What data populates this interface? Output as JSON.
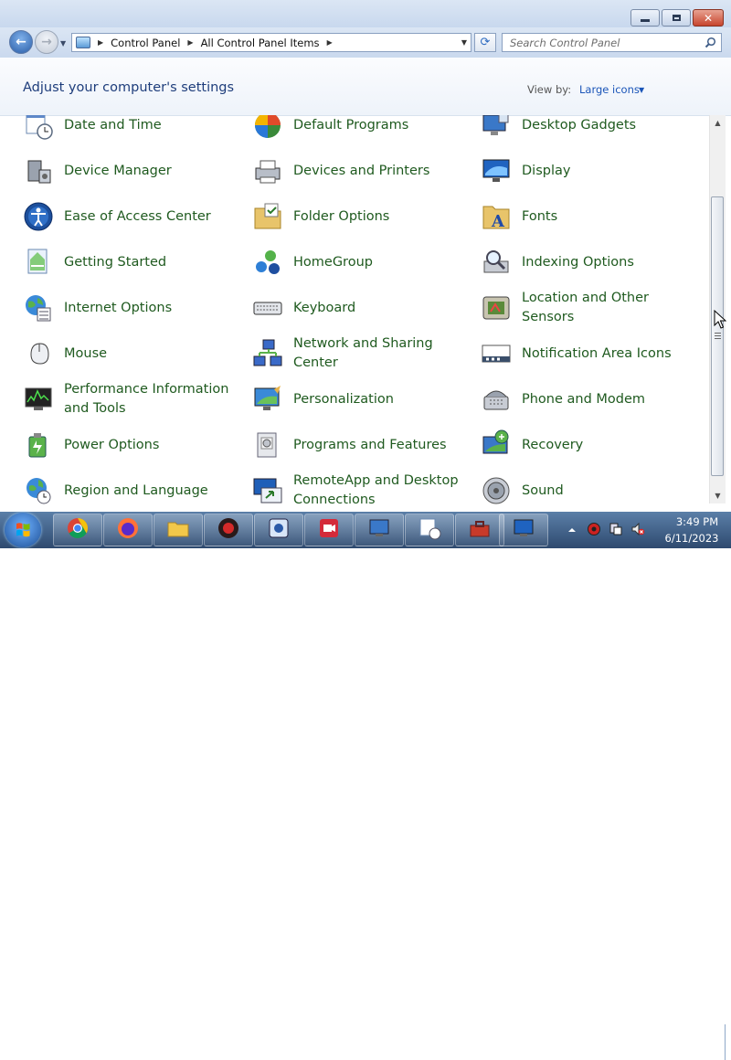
{
  "window": {
    "title_buttons": [
      "minimize",
      "maximize",
      "close"
    ],
    "close_glyph": "✕"
  },
  "nav": {
    "back_glyph": "←",
    "forward_glyph": "→",
    "breadcrumbs": [
      "Control Panel",
      "All Control Panel Items"
    ],
    "search_placeholder": "Search Control Panel"
  },
  "header": {
    "heading": "Adjust your computer's settings",
    "view_by_label": "View by:",
    "view_by_value": "Large icons"
  },
  "items": [
    {
      "label": "Date and Time",
      "icon": "date-time-icon"
    },
    {
      "label": "Default Programs",
      "icon": "default-programs-icon"
    },
    {
      "label": "Desktop Gadgets",
      "icon": "desktop-gadgets-icon"
    },
    {
      "label": "Device Manager",
      "icon": "device-manager-icon"
    },
    {
      "label": "Devices and Printers",
      "icon": "devices-printers-icon"
    },
    {
      "label": "Display",
      "icon": "display-icon"
    },
    {
      "label": "Ease of Access Center",
      "icon": "ease-of-access-icon"
    },
    {
      "label": "Folder Options",
      "icon": "folder-options-icon"
    },
    {
      "label": "Fonts",
      "icon": "fonts-icon"
    },
    {
      "label": "Getting Started",
      "icon": "getting-started-icon"
    },
    {
      "label": "HomeGroup",
      "icon": "homegroup-icon"
    },
    {
      "label": "Indexing Options",
      "icon": "indexing-options-icon"
    },
    {
      "label": "Internet Options",
      "icon": "internet-options-icon"
    },
    {
      "label": "Keyboard",
      "icon": "keyboard-icon"
    },
    {
      "label": "Location and Other Sensors",
      "icon": "location-sensors-icon"
    },
    {
      "label": "Mouse",
      "icon": "mouse-icon"
    },
    {
      "label": "Network and Sharing Center",
      "icon": "network-sharing-icon"
    },
    {
      "label": "Notification Area Icons",
      "icon": "notification-area-icon"
    },
    {
      "label": "Performance Information and Tools",
      "icon": "performance-icon"
    },
    {
      "label": "Personalization",
      "icon": "personalization-icon"
    },
    {
      "label": "Phone and Modem",
      "icon": "phone-modem-icon"
    },
    {
      "label": "Power Options",
      "icon": "power-options-icon"
    },
    {
      "label": "Programs and Features",
      "icon": "programs-features-icon"
    },
    {
      "label": "Recovery",
      "icon": "recovery-icon"
    },
    {
      "label": "Region and Language",
      "icon": "region-language-icon"
    },
    {
      "label": "RemoteApp and Desktop Connections",
      "icon": "remoteapp-icon"
    },
    {
      "label": "Sound",
      "icon": "sound-icon"
    }
  ],
  "taskbar": {
    "apps": [
      "chrome-icon",
      "firefox-icon",
      "file-explorer-icon",
      "app-icon-red",
      "app-icon-blue",
      "video-recorder-icon",
      "control-panel-icon",
      "date-time-icon",
      "toolbox-icon",
      "display-icon"
    ],
    "time": "3:49 PM",
    "date": "6/11/2023"
  },
  "colors": {
    "link_green": "#1f5a1f",
    "heading_blue": "#1e3d7b",
    "link_blue": "#1a55b8"
  }
}
